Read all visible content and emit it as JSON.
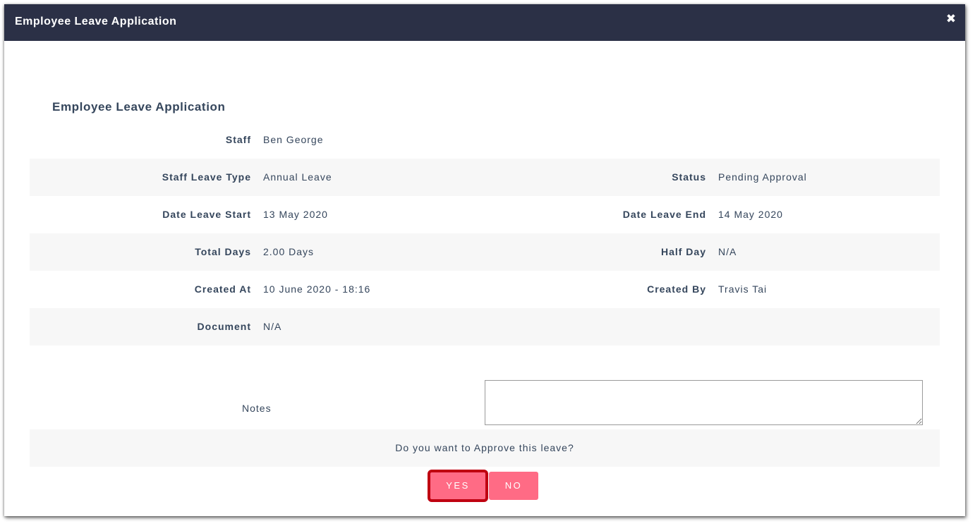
{
  "dialog": {
    "title": "Employee Leave Application",
    "close_icon": "close-icon"
  },
  "section": {
    "title": "Employee Leave Application"
  },
  "details": {
    "staff": {
      "label": "Staff",
      "value": "Ben George"
    },
    "leave_type": {
      "label": "Staff Leave Type",
      "value": "Annual Leave"
    },
    "status": {
      "label": "Status",
      "value": "Pending Approval"
    },
    "date_start": {
      "label": "Date Leave Start",
      "value": "13 May 2020"
    },
    "date_end": {
      "label": "Date Leave End",
      "value": "14 May 2020"
    },
    "total_days": {
      "label": "Total Days",
      "value": "2.00 Days"
    },
    "half_day": {
      "label": "Half Day",
      "value": "N/A"
    },
    "created_at": {
      "label": "Created At",
      "value": "10 June 2020 - 18:16"
    },
    "created_by": {
      "label": "Created By",
      "value": "Travis Tai"
    },
    "document": {
      "label": "Document",
      "value": "N/A"
    }
  },
  "notes": {
    "label": "Notes",
    "value": ""
  },
  "approval": {
    "question": "Do you want to Approve this leave?",
    "yes_label": "YES",
    "no_label": "NO"
  },
  "colors": {
    "header_bg": "#2b3046",
    "button_bg": "#ff6b85",
    "highlight_outline": "#bf0010",
    "row_shade": "#f7f7f7"
  }
}
